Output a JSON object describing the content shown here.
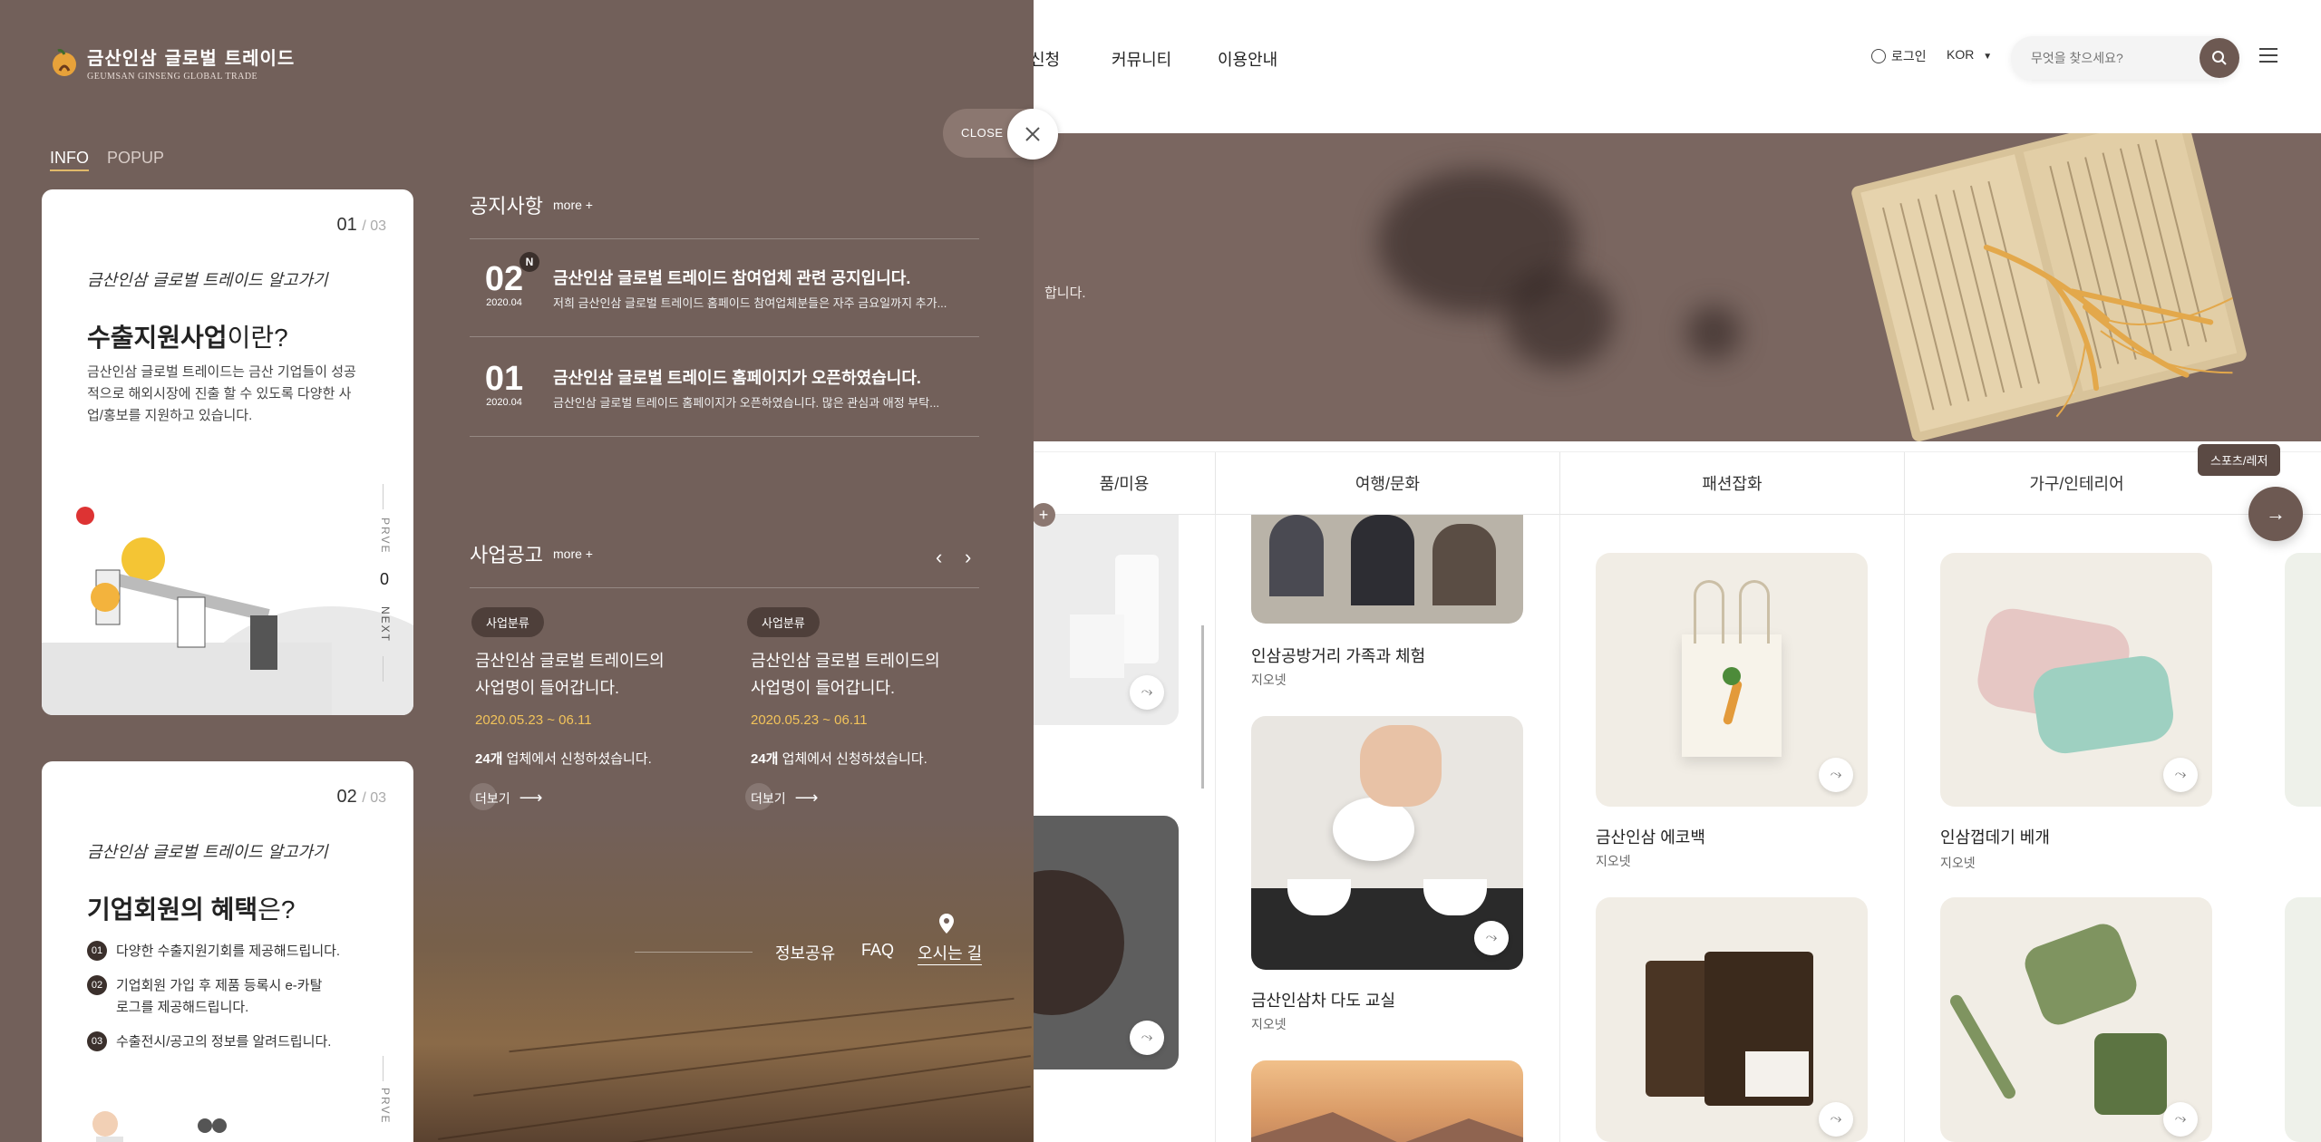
{
  "header": {
    "nav": [
      "신청",
      "커뮤니티",
      "이용안내"
    ],
    "login_label": "로그인",
    "lang_label": "KOR",
    "search_placeholder": "무엇을 찾으세요?"
  },
  "hero": {
    "text_fragment": "합니다."
  },
  "categories": [
    "품/미용",
    "여행/문화",
    "패션잡화",
    "가구/인테리어"
  ],
  "category_tooltip": "스포츠/레저",
  "products": [
    {
      "title": "인삼공방거리 가족과 체험",
      "company": "지오넷"
    },
    {
      "title": "금산인삼차 다도 교실",
      "company": "지오넷"
    },
    {
      "title": "금산인삼 에코백",
      "company": "지오넷"
    },
    {
      "title": "인삼껍데기 베개",
      "company": "지오넷"
    }
  ],
  "panel": {
    "logo_ko": "금산인삼 글로벌 트레이드",
    "logo_en": "GEUMSAN GINSENG GLOBAL TRADE",
    "tabs": [
      "INFO",
      "POPUP"
    ],
    "close_label": "CLOSE",
    "info_cards": [
      {
        "index": "01",
        "total": "03",
        "handwriting": "금산인삼 글로벌 트레이드 알고가기",
        "headline_bold": "수출지원사업",
        "headline_rest": "이란?",
        "desc": "금산인삼 글로벌 트레이드는 금산 기업들이 성공적으로 해외시장에 진출 할 수 있도록 다양한 사업/홍보를 지원하고 있습니다.",
        "prev": "PRVE",
        "page": "0",
        "next": "NEXT"
      },
      {
        "index": "02",
        "total": "03",
        "handwriting": "금산인삼 글로벌 트레이드 알고가기",
        "headline_bold": "기업회원의 혜택",
        "headline_rest": "은?",
        "items": [
          {
            "num": "01",
            "text": "다양한 수출지원기회를 제공해드립니다."
          },
          {
            "num": "02",
            "text": "기업회원 가입 후 제품 등록시 e-카탈로그를 제공해드립니다."
          },
          {
            "num": "03",
            "text": "수출전시/공고의 정보를 알려드립니다."
          }
        ],
        "prev": "PRVE"
      }
    ],
    "notices": {
      "title": "공지사항",
      "more": "more +",
      "items": [
        {
          "day": "02",
          "ym": "2020.04",
          "badge": "N",
          "title": "금산인삼 글로벌 트레이드 참여업체 관련 공지입니다.",
          "summary": "저희 금산인삼 글로벌 트레이드 홈페이드 참여업체분들은 자주 금요일까지 추가..."
        },
        {
          "day": "01",
          "ym": "2020.04",
          "title": "금산인삼 글로벌 트레이드 홈페이지가 오픈하였습니다.",
          "summary": "금산인삼 글로벌 트레이드 홈페이지가 오픈하였습니다. 많은 관심과 애정 부탁..."
        }
      ]
    },
    "business": {
      "title": "사업공고",
      "more": "more +",
      "items": [
        {
          "tag": "사업분류",
          "title_line1": "금산인삼 글로벌 트레이드의",
          "title_line2": "사업명이 들어갑니다.",
          "date": "2020.05.23 ~ 06.11",
          "count": "24개",
          "count_rest": " 업체에서 신청하셨습니다.",
          "more": "더보기"
        },
        {
          "tag": "사업분류",
          "title_line1": "금산인삼 글로벌 트레이드의",
          "title_line2": "사업명이 들어갑니다.",
          "date": "2020.05.23 ~ 06.11",
          "count": "24개",
          "count_rest": " 업체에서 신청하셨습니다.",
          "more": "더보기"
        }
      ]
    },
    "footer_links": [
      "정보공유",
      "FAQ",
      "오시는 길"
    ]
  },
  "colors": {
    "panel_bg": "#72605a",
    "accent_brown": "#6d5952",
    "date_yellow": "#f2c35a",
    "tab_underline": "#e0b96a"
  }
}
